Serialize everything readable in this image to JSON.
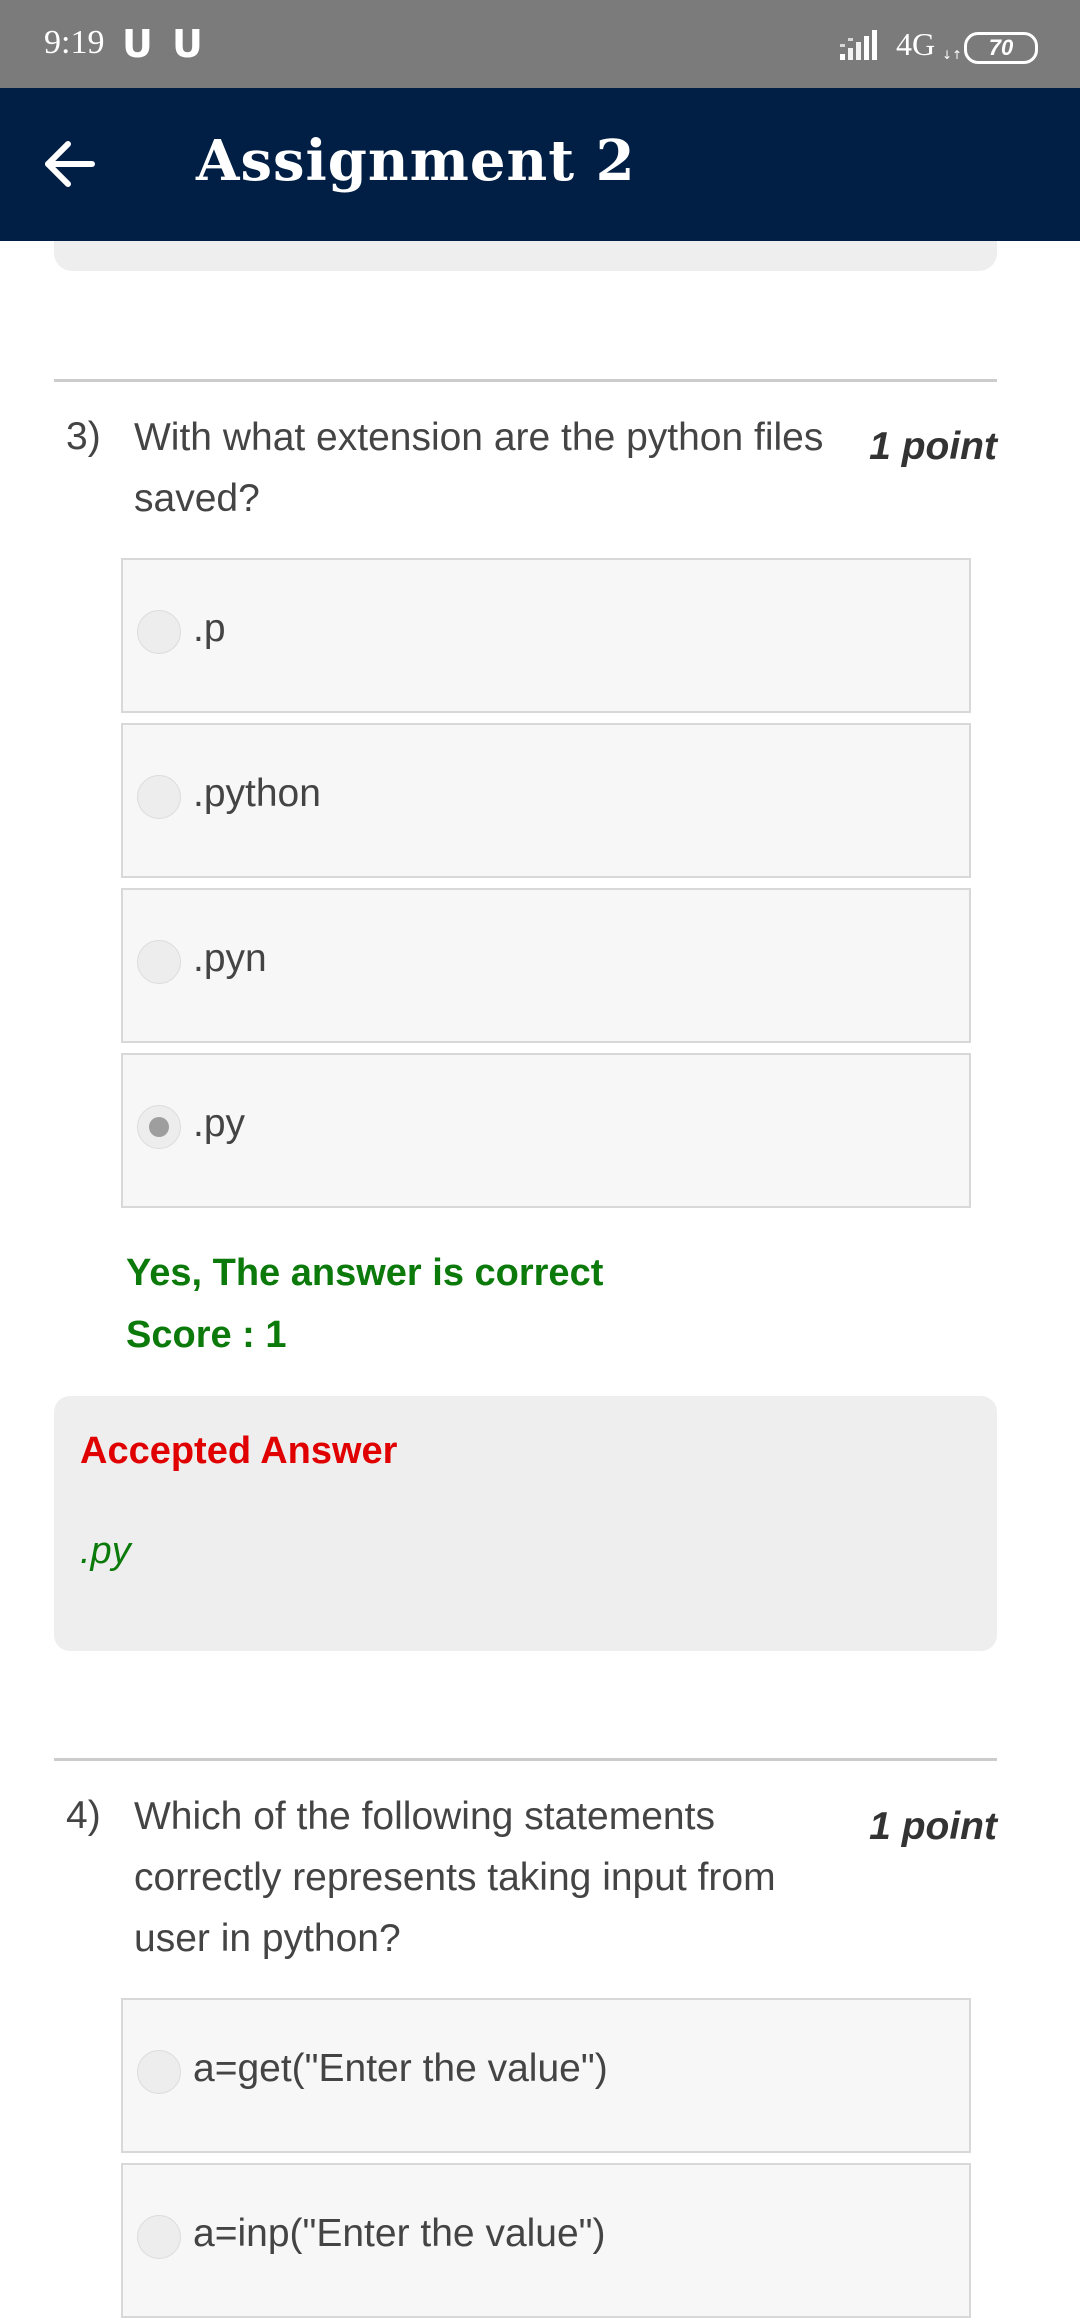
{
  "status_bar": {
    "time": "9:19",
    "notif_1": "U",
    "notif_2": "U",
    "network": "4G",
    "battery": "70"
  },
  "app_bar": {
    "back_icon": "arrow-left-icon",
    "title": "Assignment 2"
  },
  "questions": [
    {
      "number": "3)",
      "text": "With what extension are the python files saved?",
      "points": "1 point",
      "options": [
        {
          "label": ".p",
          "selected": false
        },
        {
          "label": ".python",
          "selected": false
        },
        {
          "label": ".pyn",
          "selected": false
        },
        {
          "label": ".py",
          "selected": true
        }
      ],
      "feedback": "Yes, The answer is correct",
      "score": "Score : 1",
      "accepted_title": "Accepted Answer",
      "accepted_answer": ".py"
    },
    {
      "number": "4)",
      "text": "Which of the following statements correctly represents taking input from user in python?",
      "points": "1 point",
      "options": [
        {
          "label": "a=get(\"Enter the value\")",
          "selected": false
        },
        {
          "label": "a=inp(\"Enter the value\")",
          "selected": false
        }
      ]
    }
  ],
  "colors": {
    "app_bar": "#011f44",
    "status_bar": "#7b7b7b",
    "correct_green": "#0b7a0b",
    "accepted_red": "#e00000"
  }
}
